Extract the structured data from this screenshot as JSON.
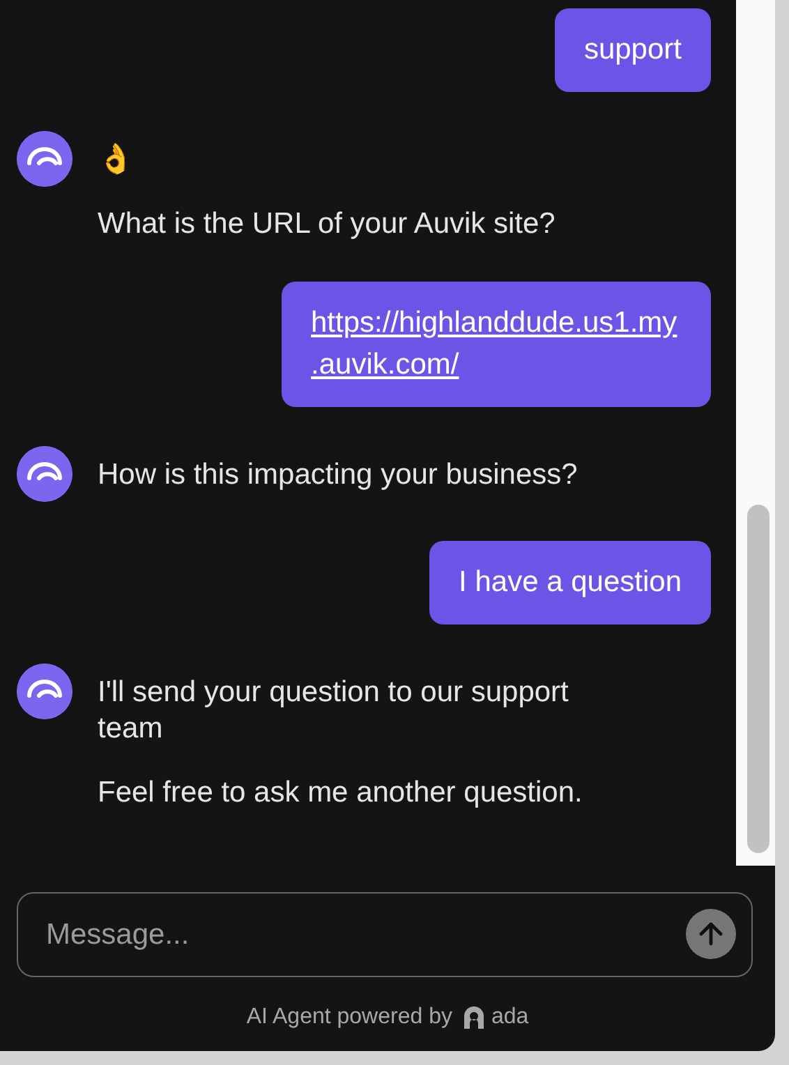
{
  "messages": [
    {
      "kind": "user",
      "text": "support",
      "link": false
    },
    {
      "kind": "bot",
      "lines": [
        "👌",
        "What is the URL of your Auvik site?"
      ]
    },
    {
      "kind": "user",
      "text": "https://highlanddude.us1.my.auvik.com/",
      "link": true
    },
    {
      "kind": "bot",
      "lines": [
        "How is this impacting your business?"
      ]
    },
    {
      "kind": "user",
      "text": "I have a question",
      "link": false
    },
    {
      "kind": "bot",
      "lines": [
        "I'll send your question to our support team",
        "Feel free to ask me another question."
      ]
    }
  ],
  "composer": {
    "placeholder": "Message..."
  },
  "footer": {
    "text": "AI Agent powered by",
    "brand": "ada"
  }
}
